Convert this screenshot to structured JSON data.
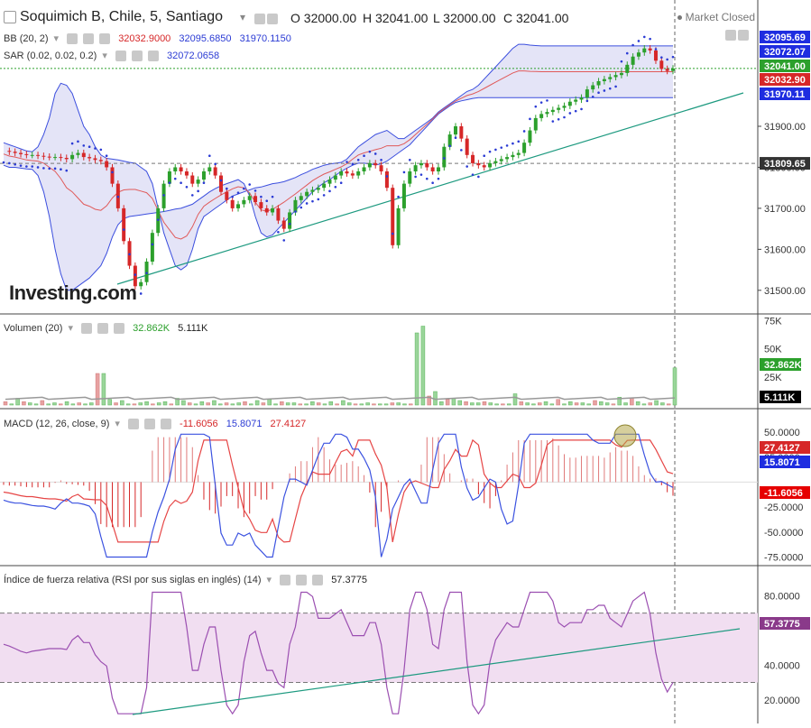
{
  "header": {
    "symbol": "Soquimich B, Chile, 5, Santiago",
    "open": "O 32000.00",
    "high": "H 32041.00",
    "low": "L 32000.00",
    "close": "C 32041.00",
    "market_status": "Market Closed"
  },
  "colors": {
    "bull": "#2ca02c",
    "bear": "#d62728",
    "bb_line": "#3b4ede",
    "bb_fill": "#e4e4f7",
    "bb_mid": "#e05a5a",
    "sar": "#2b3bd4",
    "trend": "#1e9a80",
    "macd_line": "#3b52e0",
    "macd_signal": "#e64545",
    "rsi_line": "#9b4fb1",
    "rsi_band": "#f1def1",
    "volume_ma": "#999999"
  },
  "indicators": {
    "bb": {
      "label": "BB (20, 2)",
      "basis": "32032.9000",
      "upper": "32095.6850",
      "lower": "31970.1150"
    },
    "sar": {
      "label": "SAR (0.02, 0.02, 0.2)",
      "value": "32072.0658"
    },
    "volume": {
      "label": "Volumen (20)",
      "value": "32.862K",
      "ma": "5.111K"
    },
    "macd": {
      "label": "MACD (12, 26, close, 9)",
      "hist": "-11.6056",
      "macd": "15.8071",
      "signal": "27.4127"
    },
    "rsi": {
      "label": "Índice de fuerza relativa (RSI por sus siglas en inglés) (14)",
      "value": "57.3775"
    }
  },
  "price_axis": {
    "ticks": [
      "31900.00",
      "31800.00",
      "31700.00",
      "31600.00",
      "31500.00"
    ],
    "tags": [
      "32095.69",
      "32072.07",
      "32041.00",
      "32032.90",
      "31970.11",
      "31809.65"
    ]
  },
  "volume_axis": {
    "ticks": [
      "75K",
      "50K",
      "25K"
    ],
    "tags": [
      "32.862K",
      "5.111K"
    ]
  },
  "macd_axis": {
    "ticks": [
      "50.0000",
      "25.0000",
      "-25.0000",
      "-50.0000",
      "-75.0000"
    ],
    "tags": [
      "27.4127",
      "15.8071",
      "-11.6056"
    ]
  },
  "rsi_axis": {
    "ticks": [
      "80.0000",
      "40.0000",
      "20.0000"
    ],
    "tags": [
      "57.3775"
    ]
  },
  "logo": "Investing.com",
  "chart_data": [
    {
      "type": "candlestick",
      "title": "Soquimich B, Chile, 5, Santiago",
      "ylim": [
        31460,
        32120
      ],
      "ohlc_summary": {
        "open": 32000.0,
        "high": 32041.0,
        "low": 32000.0,
        "close": 32041.0
      },
      "close_path": [
        31840,
        31838,
        31835,
        31832,
        31830,
        31830,
        31828,
        31826,
        31825,
        31825,
        31823,
        31820,
        31830,
        31835,
        31825,
        31822,
        31818,
        31815,
        31800,
        31760,
        31700,
        31620,
        31560,
        31510,
        31520,
        31570,
        31640,
        31700,
        31760,
        31790,
        31800,
        31790,
        31780,
        31760,
        31770,
        31790,
        31800,
        31780,
        31740,
        31720,
        31700,
        31710,
        31720,
        31730,
        31715,
        31700,
        31690,
        31700,
        31670,
        31650,
        31690,
        31720,
        31730,
        31740,
        31745,
        31750,
        31760,
        31770,
        31780,
        31790,
        31785,
        31780,
        31790,
        31800,
        31810,
        31805,
        31790,
        31750,
        31610,
        31700,
        31760,
        31790,
        31805,
        31810,
        31800,
        31790,
        31800,
        31850,
        31880,
        31900,
        31870,
        31830,
        31810,
        31805,
        31800,
        31810,
        31815,
        31820,
        31825,
        31830,
        31835,
        31860,
        31890,
        31920,
        31930,
        31935,
        31940,
        31945,
        31950,
        31960,
        31965,
        31970,
        31990,
        32000,
        32010,
        32015,
        32020,
        32025,
        32030,
        32050,
        32070,
        32080,
        32090,
        32085,
        32060,
        32040,
        32035,
        32041
      ],
      "bb_upper": [
        31860,
        31855,
        31850,
        31845,
        31840,
        31838,
        31850,
        31880,
        31920,
        31980,
        32005,
        32000,
        31980,
        31940,
        31900,
        31880,
        31850,
        31830,
        31822,
        31820,
        31818,
        31815,
        31812,
        31810,
        31800,
        31790,
        31760,
        31700,
        31640,
        31600,
        31560,
        31550,
        31560,
        31600,
        31650,
        31680,
        31690,
        31700,
        31710,
        31720,
        31730,
        31735,
        31740,
        31745,
        31750,
        31752,
        31756,
        31760,
        31762,
        31765,
        31770,
        31775,
        31782,
        31788,
        31795,
        31800,
        31805,
        31808,
        31810,
        31812,
        31820,
        31835,
        31850,
        31860,
        31870,
        31880,
        31885,
        31890,
        31880,
        31870,
        31870,
        31880,
        31890,
        31900,
        31910,
        31920,
        31935,
        31945,
        31955,
        31965,
        31975,
        31985,
        31990,
        32000,
        32015,
        32030,
        32045,
        32060,
        32075,
        32090,
        32100,
        32100,
        32098,
        32097,
        32096,
        32096,
        32096,
        32096,
        32096,
        32096,
        32096,
        32096,
        32096,
        32096,
        32096,
        32096,
        32096,
        32096,
        32096,
        32096,
        32096,
        32096,
        32096,
        32096,
        32096,
        32096,
        32096,
        32096
      ],
      "bb_lower": [
        31805,
        31800,
        31800,
        31798,
        31796,
        31795,
        31780,
        31740,
        31680,
        31600,
        31540,
        31500,
        31500,
        31510,
        31520,
        31530,
        31545,
        31560,
        31590,
        31630,
        31660,
        31675,
        31680,
        31682,
        31684,
        31686,
        31688,
        31690,
        31692,
        31695,
        31698,
        31700,
        31705,
        31710,
        31720,
        31730,
        31740,
        31748,
        31755,
        31760,
        31765,
        31770,
        31760,
        31730,
        31680,
        31640,
        31630,
        31635,
        31650,
        31665,
        31680,
        31695,
        31710,
        31725,
        31740,
        31752,
        31762,
        31770,
        31780,
        31790,
        31798,
        31805,
        31810,
        31810,
        31808,
        31806,
        31808,
        31815,
        31825,
        31835,
        31845,
        31855,
        31870,
        31885,
        31900,
        31915,
        31930,
        31940,
        31950,
        31958,
        31962,
        31965,
        31968,
        31970,
        31970,
        31970,
        31970,
        31970,
        31970,
        31970,
        31970,
        31970,
        31970,
        31970,
        31970,
        31970,
        31970,
        31970,
        31970,
        31970,
        31970,
        31970,
        31970,
        31970,
        31970,
        31970,
        31970,
        31970,
        31970,
        31970,
        31970,
        31970,
        31970,
        31970,
        31970,
        31970,
        31970,
        31970
      ],
      "last_price": 32041.0,
      "reference_level": 31809.65
    },
    {
      "type": "bar",
      "title": "Volumen (20)",
      "ylim": [
        0,
        80000
      ],
      "volume_values_k": [
        3,
        1,
        6,
        3,
        2,
        1,
        4,
        1,
        2,
        1,
        3,
        1,
        2,
        1,
        2,
        28,
        28,
        5,
        2,
        4,
        1,
        1,
        2,
        3,
        1,
        2,
        3,
        1,
        6,
        4,
        2,
        1,
        3,
        2,
        4,
        1,
        2,
        1,
        2,
        3,
        1,
        4,
        2,
        5,
        1,
        3,
        2,
        2,
        1,
        1,
        3,
        2,
        1,
        3,
        1,
        4,
        2,
        1,
        1,
        2,
        1,
        1,
        1,
        2,
        2,
        1,
        1,
        64,
        70,
        8,
        12,
        3,
        5,
        6,
        4,
        3,
        2,
        2,
        3,
        2,
        1,
        1,
        1,
        10,
        3,
        2,
        1,
        2,
        3,
        1,
        5,
        1,
        3,
        2,
        2,
        1,
        4,
        3,
        2,
        1,
        7,
        2,
        6,
        3,
        1,
        2,
        4,
        2,
        1,
        33
      ],
      "ma_value_k": 5.111,
      "last_value_k": 32.862
    },
    {
      "type": "line",
      "title": "MACD (12, 26, close, 9)",
      "ylim": [
        -80,
        60
      ],
      "values": {
        "histogram": -11.6056,
        "macd": 15.8071,
        "signal": 27.4127
      }
    },
    {
      "type": "line",
      "title": "RSI (14)",
      "ylim": [
        10,
        88
      ],
      "band": [
        30,
        70
      ],
      "values": {
        "rsi": 57.3775
      }
    }
  ]
}
